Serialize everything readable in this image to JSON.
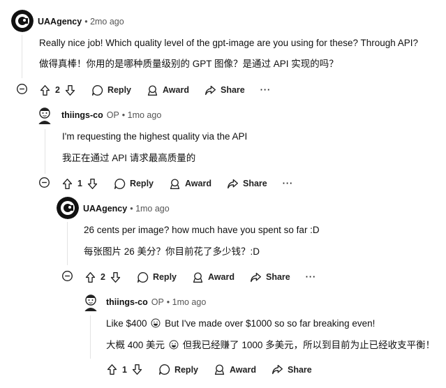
{
  "comments": [
    {
      "author": "UAAgency",
      "op": "",
      "time": "• 2mo ago",
      "line1": "Really nice job! Which quality level of the gpt-image are you using for these? Through API?",
      "line2": "做得真棒！你用的是哪种质量级别的 GPT 图像？是通过 API 实现的吗？",
      "votes": "2",
      "avatar": "ua-logo"
    },
    {
      "author": "thiings-co",
      "op": "OP",
      "time": "• 1mo ago",
      "line1": "I'm requesting the highest quality via the API",
      "line2": "我正在通过 API 请求最高质量的",
      "votes": "1",
      "avatar": "cartoon-person"
    },
    {
      "author": "UAAgency",
      "op": "",
      "time": "• 1mo ago",
      "line1": "26 cents per image? how much have you spent so far :D",
      "line2": "每张图片 26 美分？你目前花了多少钱？:D",
      "votes": "2",
      "avatar": "ua-logo"
    },
    {
      "author": "thiings-co",
      "op": "OP",
      "time": "• 1mo ago",
      "line1a": "Like $400",
      "line1b": "But I've made over $1000 so so far breaking even!",
      "line2a": "大概 400 美元",
      "line2b": "但我已经赚了 1000 多美元，所以到目前为止已经收支平衡！",
      "votes": "1",
      "avatar": "cartoon-person"
    }
  ],
  "actions": {
    "reply": "Reply",
    "award": "Award",
    "share": "Share",
    "more": "···"
  },
  "icons": [
    "collapse-icon",
    "upvote-icon",
    "downvote-icon",
    "reply-icon",
    "award-icon",
    "share-icon",
    "more-icon",
    "grin-emoji"
  ]
}
